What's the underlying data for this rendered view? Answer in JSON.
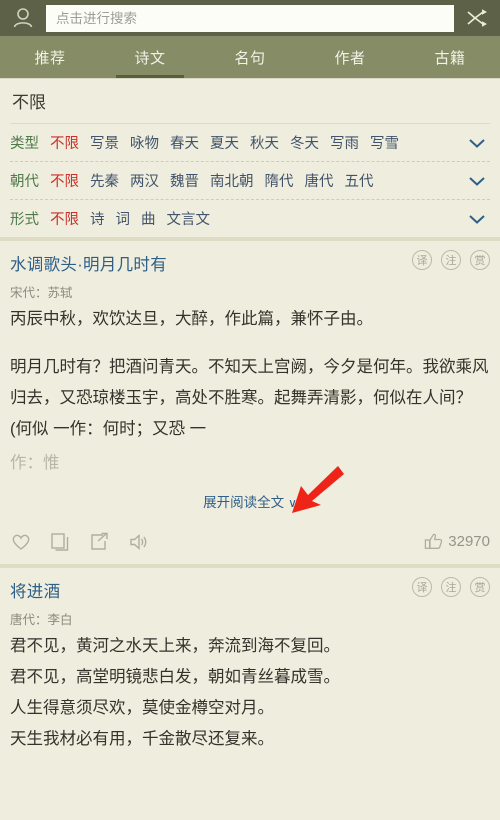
{
  "topbar": {
    "profile_icon": "person-icon",
    "shuffle_icon": "shuffle-icon",
    "search_placeholder": "点击进行搜索",
    "search_value": "",
    "bg_color": "#5d6148"
  },
  "tabs": {
    "active_index": 1,
    "items": [
      {
        "label": "推荐"
      },
      {
        "label": "诗文"
      },
      {
        "label": "名句"
      },
      {
        "label": "作者"
      },
      {
        "label": "古籍"
      }
    ],
    "bg_color": "#858c66",
    "underline_color": "#585f3e"
  },
  "filters": {
    "heading": "不限",
    "rows": [
      {
        "label": "类型",
        "options": [
          "不限",
          "写景",
          "咏物",
          "春天",
          "夏天",
          "秋天",
          "冬天",
          "写雨",
          "写雪"
        ],
        "selected": "不限",
        "chevron_icon": "chevron-down-icon"
      },
      {
        "label": "朝代",
        "options": [
          "不限",
          "先秦",
          "两汉",
          "魏晋",
          "南北朝",
          "隋代",
          "唐代",
          "五代"
        ],
        "selected": "不限",
        "chevron_icon": "chevron-down-icon"
      },
      {
        "label": "形式",
        "options": [
          "不限",
          "诗",
          "词",
          "曲",
          "文言文"
        ],
        "selected": "不限",
        "chevron_icon": "chevron-down-icon"
      }
    ],
    "label_color": "#4f7a4a",
    "selected_color": "#c9322b",
    "option_color": "#42546b"
  },
  "poems": [
    {
      "title": "水调歌头·明月几时有",
      "author": "宋代：苏轼",
      "badges": [
        "译",
        "注",
        "赏"
      ],
      "preface": "丙辰中秋，欢饮达旦，大醉，作此篇，兼怀子由。",
      "body": "明月几时有？把酒问青天。不知天上宫阙，今夕是何年。我欲乘风归去，又恐琼楼玉宇，高处不胜寒。起舞弄清影，何似在人间？(何似 一作：何时；又恐 一",
      "body_fade": "作：惟",
      "expand_label": "展开阅读全文",
      "expand_chevron": "∨",
      "actions": [
        "heart-icon",
        "copy-icon",
        "share-icon",
        "speaker-icon"
      ],
      "like_icon": "thumbs-up-icon",
      "like_count": "32970"
    },
    {
      "title": "将进酒",
      "author": "唐代：李白",
      "badges": [
        "译",
        "注",
        "赏"
      ],
      "preface": "",
      "body": "君不见，黄河之水天上来，奔流到海不复回。\n君不见，高堂明镜悲白发，朝如青丝暮成雪。\n人生得意须尽欢，莫使金樽空对月。\n天生我材必有用，千金散尽还复来。",
      "body_fade": "",
      "expand_label": "",
      "expand_chevron": "",
      "actions": [],
      "like_icon": "",
      "like_count": ""
    }
  ],
  "annotation": {
    "arrow_color": "#ef2418",
    "arrow_name": "red-pointer-arrow"
  }
}
